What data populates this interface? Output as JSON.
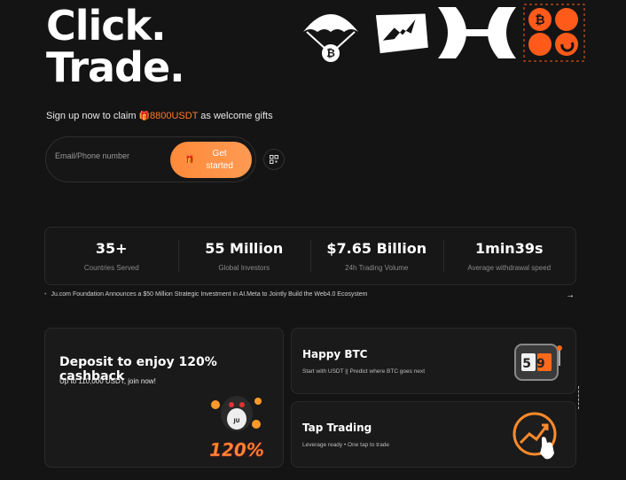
{
  "hero": {
    "line1": "Click.",
    "line2": "Trade."
  },
  "promo_icons": [
    "airdrop-btc-icon",
    "flash-trade-icon",
    "exchange-icon",
    "crypto-coins-icon"
  ],
  "signup": {
    "pre_text": "Sign up now to claim ",
    "highlight": "8800USDT",
    "post_text": " as welcome gifts",
    "placeholder": "Email/Phone number",
    "button_label": "Get started",
    "qr_icon": "qr-code-icon"
  },
  "stats": [
    {
      "value": "35+",
      "label": "Countries Served"
    },
    {
      "value": "55 Million",
      "label": "Global Investors"
    },
    {
      "value": "$7.65 Billion",
      "label": "24h Trading Volume"
    },
    {
      "value": "1min39s",
      "label": "Average withdrawal speed"
    }
  ],
  "news": {
    "text": "Ju.com Foundation Announces a $50 Million Strategic Investment in AI.Meta to Jointly Build the Web4.0 Ecosystem"
  },
  "cards": {
    "deposit": {
      "title": "Deposit to enjoy 120% cashback",
      "subtitle": "Up to 110,000 USDT, join now!",
      "badge": "120%"
    },
    "happy_btc": {
      "title": "Happy BTC",
      "subtitle": "Start with USDT || Predict where BTC goes next",
      "slot_digits": "59"
    },
    "tap_trading": {
      "title": "Tap Trading",
      "subtitle": "Leverage ready • One tap to trade"
    }
  },
  "colors": {
    "accent": "#ff8a3a",
    "background": "#141414",
    "card": "#1a1a1a"
  }
}
